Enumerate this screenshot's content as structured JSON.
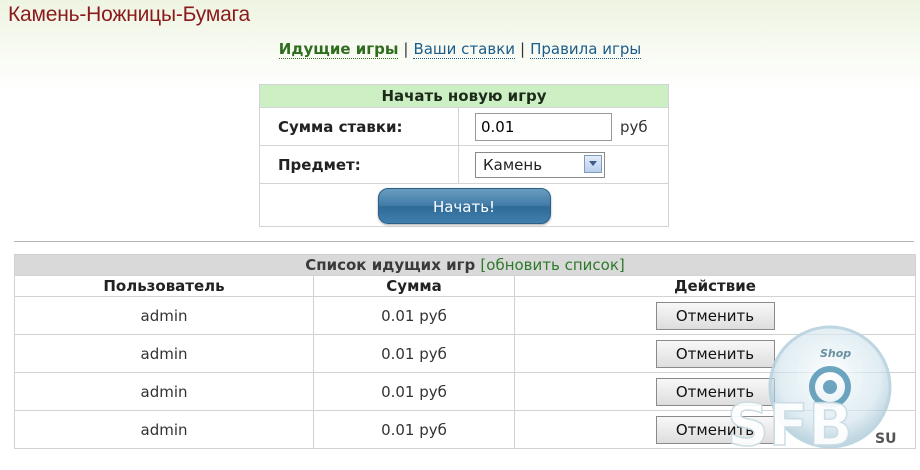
{
  "page": {
    "title": "Камень-Ножницы-Бумага"
  },
  "nav": {
    "items": [
      {
        "label": "Идущие игры",
        "active": true
      },
      {
        "label": "Ваши ставки",
        "active": false
      },
      {
        "label": "Правила игры",
        "active": false
      }
    ],
    "separator": "|"
  },
  "new_game": {
    "title": "Начать новую игру",
    "bet_label": "Сумма ставки:",
    "bet_value": "0.01",
    "bet_unit": "руб",
    "item_label": "Предмет:",
    "item_selected": "Камень",
    "start_label": "Начать!"
  },
  "games_list": {
    "title": "Список идущих игр",
    "refresh_label": "[обновить список]",
    "columns": [
      "Пользователь",
      "Сумма",
      "Действие"
    ],
    "rows": [
      {
        "user": "admin",
        "amount": "0.01 руб",
        "action": "Отменить"
      },
      {
        "user": "admin",
        "amount": "0.01 руб",
        "action": "Отменить"
      },
      {
        "user": "admin",
        "amount": "0.01 руб",
        "action": "Отменить"
      },
      {
        "user": "admin",
        "amount": "0.01 руб",
        "action": "Отменить"
      }
    ]
  },
  "watermark": {
    "top_text": "Shop",
    "main_text": "SFB",
    "suffix": "SU"
  },
  "colors": {
    "title": "#8b1a1a",
    "nav_active": "#2f6d1e",
    "form_header": "#ccf0c4",
    "list_header": "#d9d9d9",
    "start_button": "#3f7aa6",
    "refresh_link": "#2d7a2a"
  }
}
